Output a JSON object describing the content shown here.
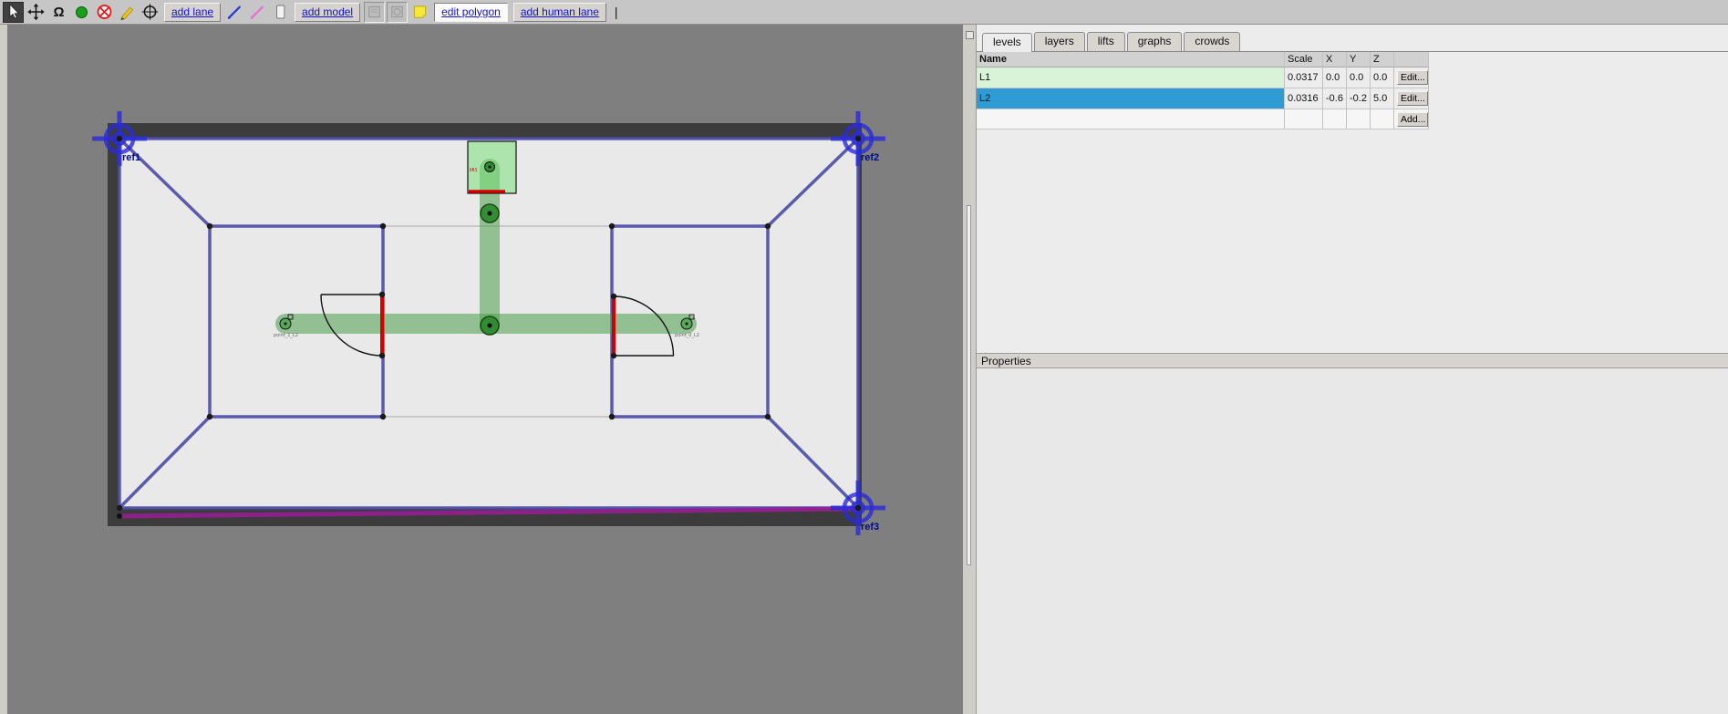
{
  "toolbar": {
    "icons": [
      "pointer",
      "move",
      "rotate",
      "add-vertex",
      "delete",
      "measure-pencil",
      "add-fiducial",
      "wall-pen",
      "measurement-pen",
      "floor-polygon",
      "disabled-tool-a",
      "disabled-tool-b",
      "note"
    ],
    "buttons": {
      "add_lane": "add lane",
      "add_model": "add model",
      "edit_polygon": "edit polygon",
      "add_human_lane": "add human lane"
    },
    "cursor": "|"
  },
  "canvas": {
    "fiducials": [
      "ref1",
      "ref2",
      "ref3"
    ],
    "lift_label": "lift1",
    "vertex_labels": [
      "point_1_L2",
      "point_0_L2"
    ]
  },
  "panel": {
    "tabs": [
      "levels",
      "layers",
      "lifts",
      "graphs",
      "crowds"
    ],
    "active_tab": "levels",
    "levels_table": {
      "headers": [
        "Name",
        "Scale",
        "X",
        "Y",
        "Z"
      ],
      "rows": [
        {
          "name": "L1",
          "scale": "0.0317",
          "x": "0.0",
          "y": "0.0",
          "z": "0.0",
          "action": "Edit..."
        },
        {
          "name": "L2",
          "scale": "0.0316",
          "x": "-0.6",
          "y": "-0.2",
          "z": "5.0",
          "action": "Edit..."
        }
      ],
      "add_button": "Add..."
    },
    "properties_label": "Properties"
  },
  "colors": {
    "selected_row": "#2e9bd4",
    "l1_row": "#d8f3d8",
    "lane_green": "#4a9e4a",
    "wall_blue": "#4d4da8",
    "fiducial_blue": "#2b2bdb",
    "door_red": "#d40000",
    "measure_purple": "#9c1d98",
    "link_blue": "#1414c8",
    "canvas_bg": "#7f7f7f"
  }
}
